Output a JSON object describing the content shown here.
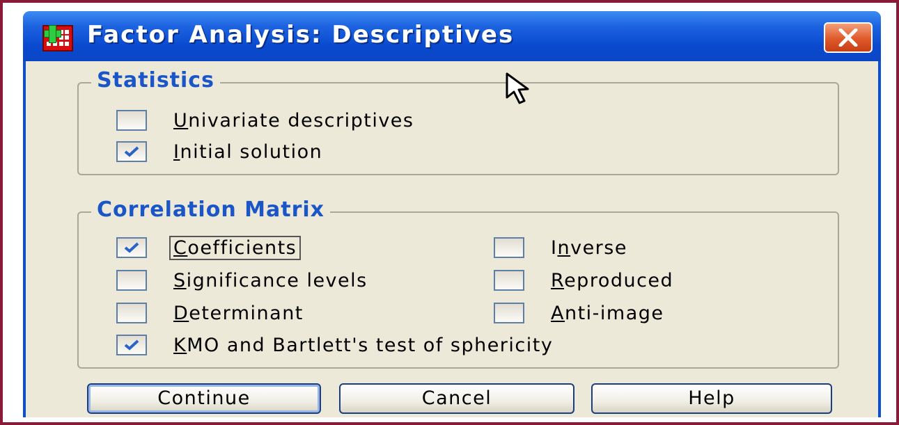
{
  "window": {
    "title": "Factor Analysis: Descriptives"
  },
  "statistics": {
    "legend": "Statistics",
    "options": [
      {
        "pre": "",
        "ul": "U",
        "post": "nivariate descriptives",
        "checked": false
      },
      {
        "pre": "",
        "ul": "I",
        "post": "nitial solution",
        "checked": true
      }
    ]
  },
  "correlation": {
    "legend": "Correlation Matrix",
    "options": [
      {
        "pre": "",
        "ul": "C",
        "post": "oefficients",
        "checked": true
      },
      {
        "pre": "I",
        "ul": "n",
        "post": "verse",
        "checked": false
      },
      {
        "pre": "",
        "ul": "S",
        "post": "ignificance levels",
        "checked": false
      },
      {
        "pre": "",
        "ul": "R",
        "post": "eproduced",
        "checked": false
      },
      {
        "pre": "",
        "ul": "D",
        "post": "eterminant",
        "checked": false
      },
      {
        "pre": "",
        "ul": "A",
        "post": "nti-image",
        "checked": false
      },
      {
        "pre": "",
        "ul": "K",
        "post": "MO and Bartlett's test of sphericity",
        "checked": true
      }
    ]
  },
  "buttons": {
    "continue": "Continue",
    "cancel": "Cancel",
    "help": "Help"
  },
  "icons": {
    "app": "spss-dialog-icon",
    "close": "close-icon",
    "check": "check-icon",
    "cursor": "mouse-pointer-icon"
  },
  "colors": {
    "title_bar": "#0b4fd6",
    "legend_text": "#1b56c9",
    "close_button": "#e0592a",
    "frame": "#8b1a38",
    "client": "#ece9d8"
  }
}
